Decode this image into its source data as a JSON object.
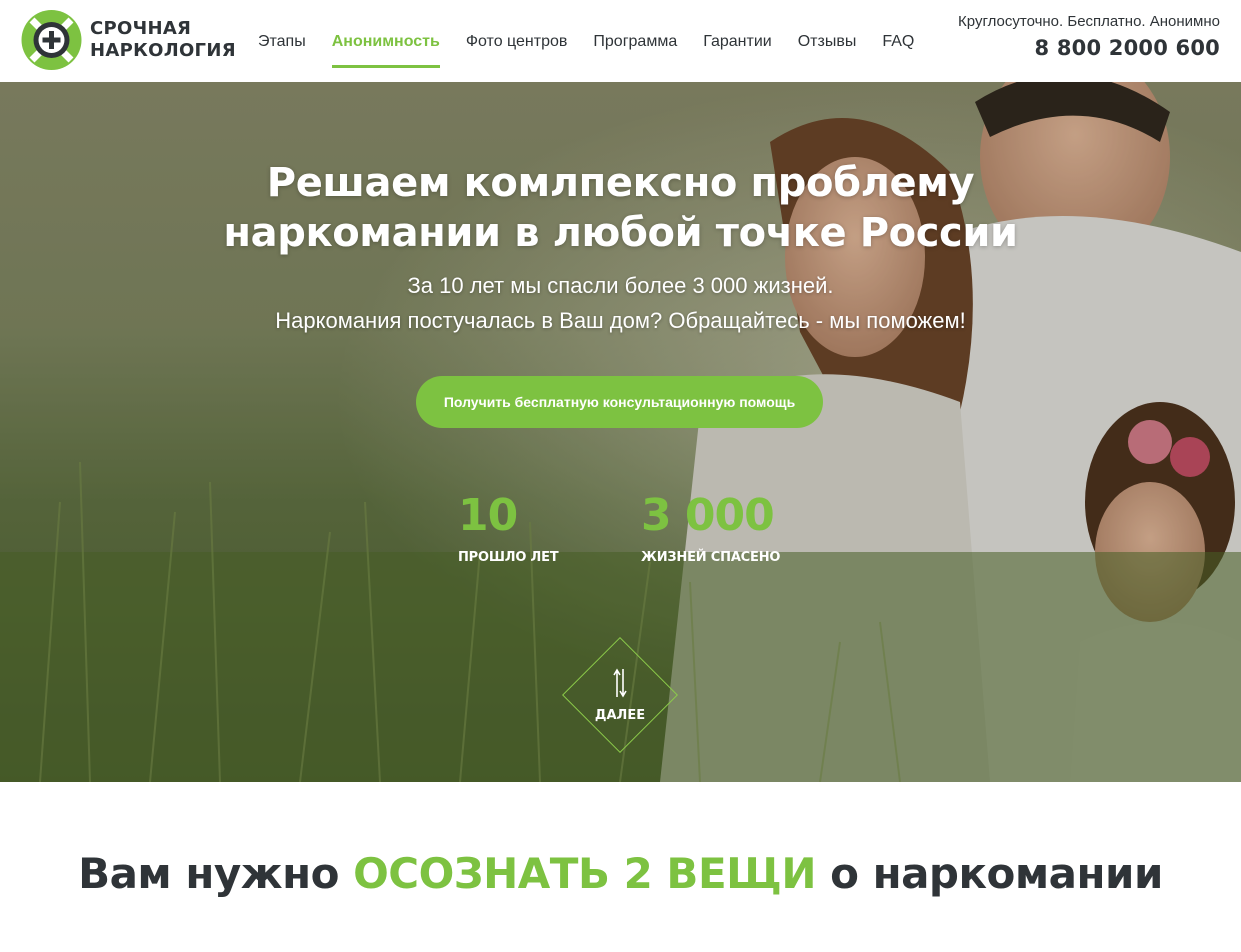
{
  "header": {
    "logo_line1": "СРОЧНАЯ",
    "logo_line2": "НАРКОЛОГИЯ",
    "nav": [
      {
        "label": "Этапы",
        "active": false
      },
      {
        "label": "Анонимность",
        "active": true
      },
      {
        "label": "Фото центров",
        "active": false
      },
      {
        "label": "Программа",
        "active": false
      },
      {
        "label": "Гарантии",
        "active": false
      },
      {
        "label": "Отзывы",
        "active": false
      },
      {
        "label": "FAQ",
        "active": false
      }
    ],
    "tagline": "Круглосуточно. Бесплатно. Анонимно",
    "phone": "8 800 2000 600"
  },
  "hero": {
    "title_line1": "Решаем комлпексно проблему",
    "title_line2": "наркомании в любой точке России",
    "subtitle_line1": "За 10 лет мы спасли более 3 000 жизней.",
    "subtitle_line2": "Наркомания постучалась в Ваш дом? Обращайтесь - мы поможем!",
    "cta_label": "Получить бесплатную консультационную помощь",
    "stats": [
      {
        "value": "10",
        "label": "ПРОШЛО ЛЕТ"
      },
      {
        "value": "3 000",
        "label": "ЖИЗНЕЙ СПАСЕНО"
      }
    ],
    "next_label": "ДАЛЕЕ",
    "next_icon": "up-down-arrows-icon"
  },
  "section": {
    "title_prefix": "Вам нужно ",
    "title_highlight": "ОСОЗНАТЬ 2 ВЕЩИ",
    "title_suffix": " о наркомании"
  },
  "colors": {
    "accent": "#7dc241",
    "text": "#2f3438",
    "white": "#ffffff"
  }
}
